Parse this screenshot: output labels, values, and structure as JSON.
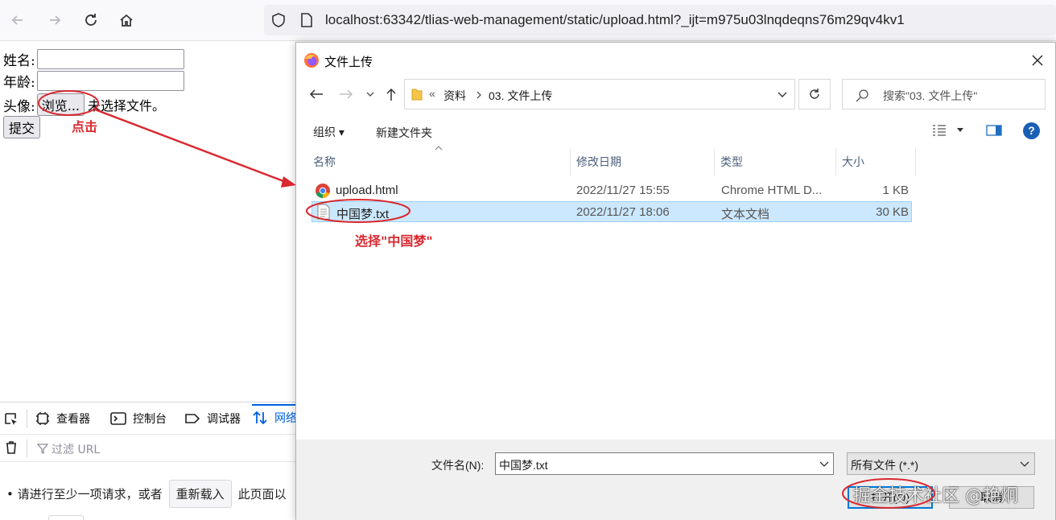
{
  "browser": {
    "url": "localhost:63342/tlias-web-management/static/upload.html?_ijt=m975u03lnqdeqns76m29qv4kv1"
  },
  "form": {
    "name_label": "姓名:",
    "age_label": "年龄:",
    "avatar_label": "头像:",
    "browse_button": "浏览...",
    "no_file_text": "未选择文件。",
    "submit_button": "提交"
  },
  "devtools": {
    "tabs": [
      "查看器",
      "控制台",
      "调试器",
      "网络"
    ],
    "filter_placeholder": "过滤 URL",
    "message_prefix": "• 请进行至少一项请求，或者",
    "reload_button": "重新载入",
    "message_suffix": "此页面以"
  },
  "dialog": {
    "title": "文件上传",
    "breadcrumb": {
      "overflow": "«",
      "items": [
        "资料",
        "03. 文件上传"
      ]
    },
    "search_placeholder": "搜索\"03. 文件上传\"",
    "toolbar": {
      "organize": "组织 ▾",
      "new_folder": "新建文件夹"
    },
    "columns": [
      "名称",
      "修改日期",
      "类型",
      "大小"
    ],
    "files": [
      {
        "name": "upload.html",
        "date": "2022/11/27 15:55",
        "type": "Chrome HTML D...",
        "size": "1 KB",
        "icon": "chrome-icon",
        "selected": false
      },
      {
        "name": "中国梦.txt",
        "date": "2022/11/27 18:06",
        "type": "文本文档",
        "size": "30 KB",
        "icon": "text-file-icon",
        "selected": true
      }
    ],
    "filename_label": "文件名(N):",
    "filename_value": "中国梦.txt",
    "filetype_value": "所有文件 (*.*)",
    "open_button": "打开(O)",
    "cancel_button": "取消"
  },
  "annotations": {
    "click_label": "点击",
    "select_label": "选择\"中国梦\"",
    "color": "#d9282f"
  },
  "watermark": "掘金技术社区 @艳炯"
}
